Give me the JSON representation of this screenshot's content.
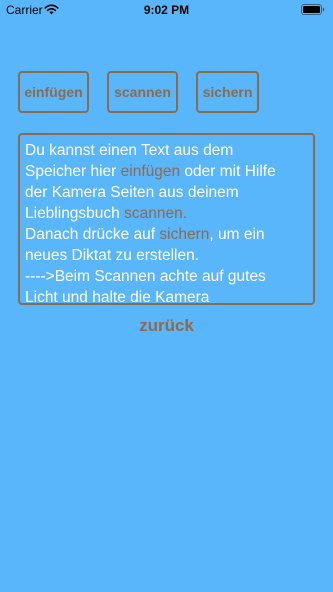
{
  "status_bar": {
    "carrier": "Carrier",
    "time": "9:02 PM",
    "wifi_icon": "wifi-icon",
    "battery_icon": "battery-icon"
  },
  "toolbar": {
    "insert_label": "einfügen",
    "scan_label": "scannen",
    "save_label": "sichern"
  },
  "info": {
    "line1": "Du kannst einen Text aus dem",
    "line2_a": "Speicher hier ",
    "line2_kw": "einfügen",
    "line2_b": " oder mit Hilfe",
    "line3": "der Kamera Seiten aus deinem",
    "line4_a": "Lieblingsbuch ",
    "line4_kw": "scannen",
    "line4_b": ".",
    "line5_a": "Danach drücke auf ",
    "line5_kw": "sichern",
    "line5_b": ", um ein",
    "line6": "neues Diktat zu erstellen.",
    "line7": "---->Beim Scannen achte auf gutes",
    "line8": "Licht und halte die Kamera"
  },
  "back_label": "zurück",
  "colors": {
    "background": "#5ab6fb",
    "accent": "#8c6c4e",
    "text": "#ffffff"
  }
}
